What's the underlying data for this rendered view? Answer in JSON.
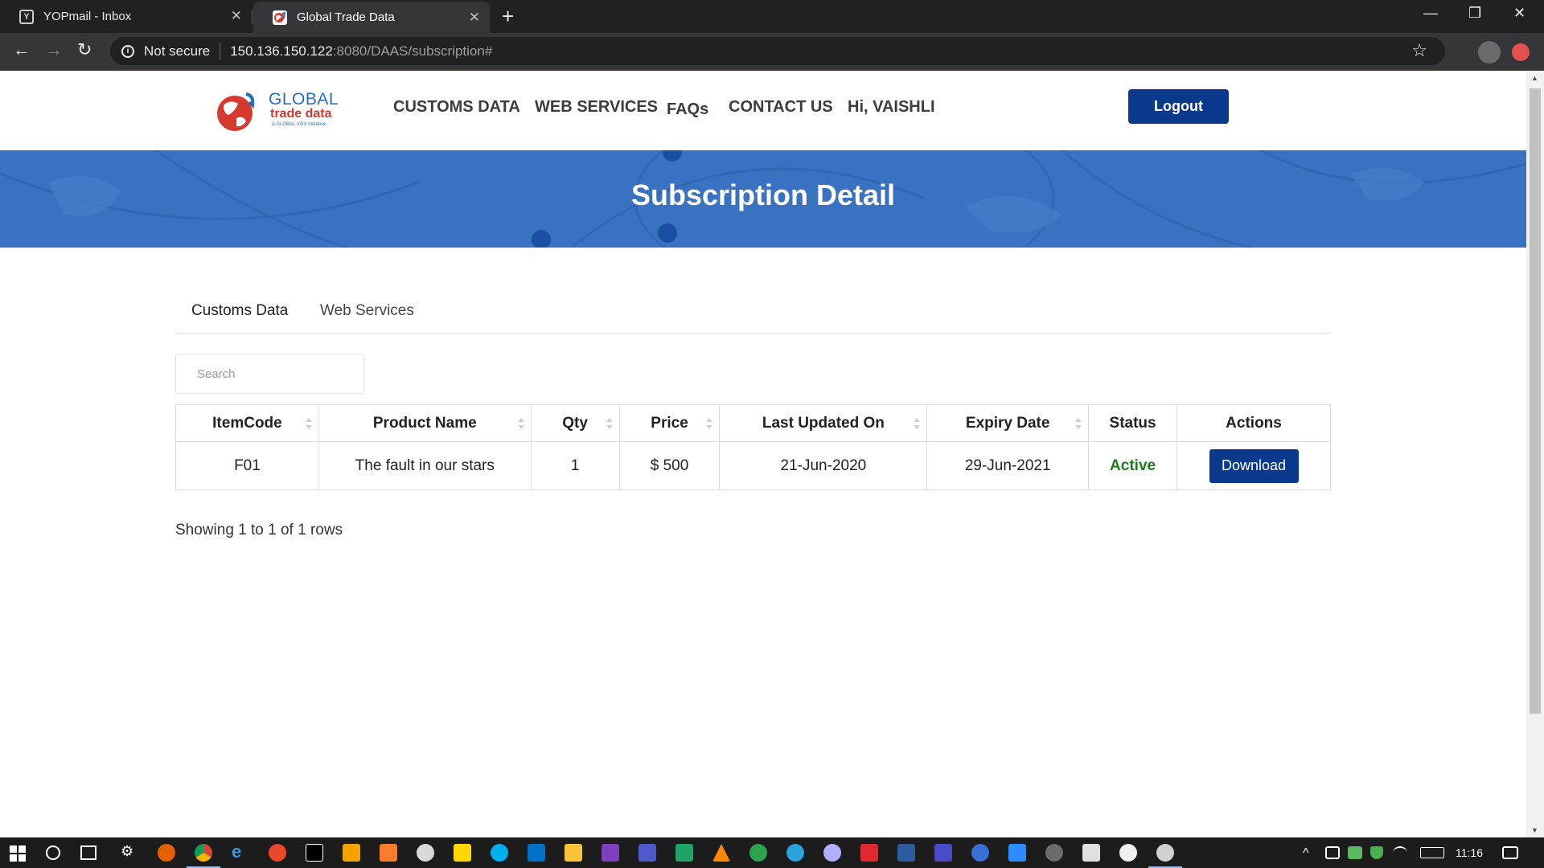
{
  "browser": {
    "tabs": [
      {
        "title": "YOPmail - Inbox",
        "favicon": "Y"
      },
      {
        "title": "Global Trade Data"
      }
    ],
    "address_bar": {
      "security": "Not secure",
      "host": "150.136.150.122",
      "path": ":8080/DAAS/subscription#"
    }
  },
  "site": {
    "logo": {
      "line1": "GLOBAL",
      "line2": "trade data",
      "line3": "A GLOBAL VOX Initiative"
    },
    "nav": {
      "customs_data": "CUSTOMS DATA",
      "web_services": "WEB SERVICES",
      "faqs": "FAQs",
      "contact_us": "CONTACT US",
      "greeting": "Hi, VAISHLI"
    },
    "logout_label": "Logout"
  },
  "banner": {
    "title": "Subscription Detail"
  },
  "subscription": {
    "tabs": [
      "Customs Data",
      "Web Services"
    ],
    "search": {
      "placeholder": "Search",
      "value": ""
    },
    "table": {
      "headers": [
        "ItemCode",
        "Product Name",
        "Qty",
        "Price",
        "Last Updated On",
        "Expiry Date",
        "Status",
        "Actions"
      ],
      "rows": [
        {
          "item_code": "F01",
          "product_name": "The fault in our stars",
          "qty": "1",
          "price": "$ 500",
          "last_updated_on": "21-Jun-2020",
          "expiry_date": "29-Jun-2021",
          "status": "Active",
          "action_label": "Download"
        }
      ]
    },
    "pagination_info": "Showing 1 to 1 of 1 rows"
  },
  "taskbar": {
    "clock": "11:16"
  },
  "colors": {
    "brand_blue": "#0b3a8c",
    "banner_blue": "#3a72c2",
    "status_active": "#1e7a1e"
  }
}
